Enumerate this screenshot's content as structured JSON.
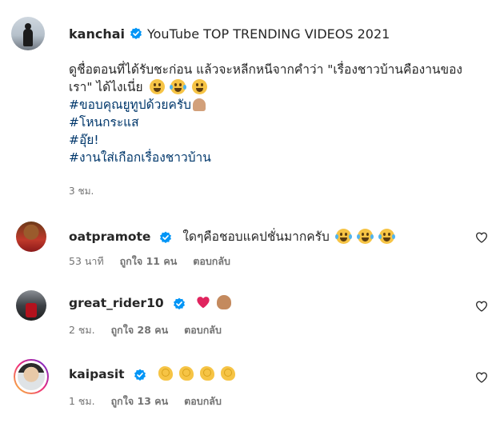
{
  "post": {
    "username": "kanchai",
    "title": "YouTube TOP TRENDING VIDEOS 2021",
    "caption_line1": "ดูชื่อตอนที่ได้รับชะก่อน แล้วจะหลีกหนีจากคำว่า \"เรื่องชาวบ้านคืองานของ",
    "caption_line2": "เรา\" ได้ไงเนี่ย",
    "hashtags": [
      "#ขอบคุณยูทูปด้วยครับ",
      "#โหนกระแส",
      "#อุ๊ย!",
      "#งานใส่เกือกเรื่องชาวบ้าน"
    ],
    "time": "3 ชม.",
    "emojis": [
      "winking-tongue-emoji",
      "tears-of-joy-emoji",
      "smiling-face-emoji"
    ]
  },
  "comments": [
    {
      "username": "oatpramote",
      "text": "ใดๆคือชอบแคปชั่นมากครับ",
      "emojis": [
        "tears-of-joy-emoji",
        "tears-of-joy-emoji",
        "tears-of-joy-emoji"
      ],
      "time": "53 นาที",
      "likes": "ถูกใจ 11 คน",
      "reply": "ตอบกลับ"
    },
    {
      "username": "great_rider10",
      "text": "",
      "emojis": [
        "red-heart-emoji",
        "flexed-biceps-emoji"
      ],
      "time": "2 ชม.",
      "likes": "ถูกใจ 28 คน",
      "reply": "ตอบกลับ"
    },
    {
      "username": "kaipasit",
      "text": "",
      "emojis": [
        "clapping-hands-emoji",
        "clapping-hands-emoji",
        "clapping-hands-emoji",
        "clapping-hands-emoji"
      ],
      "time": "1 ชม.",
      "likes": "ถูกใจ 13 คน",
      "reply": "ตอบกลับ"
    }
  ],
  "colors": {
    "verified": "#0095f6",
    "hashtag": "#00376b",
    "meta": "#737373",
    "text": "#262626"
  }
}
